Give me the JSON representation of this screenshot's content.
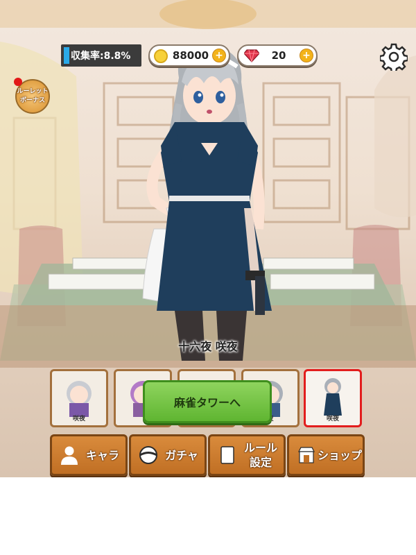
{
  "hud": {
    "collection_rate": "収集率:8.8%",
    "coins": "88000",
    "gems": "20",
    "coin_plus": "+",
    "gem_plus": "+"
  },
  "roulette_bonus": {
    "line1": "ルーレット",
    "line2": "ボーナス"
  },
  "character": {
    "name": "十六夜 咲夜"
  },
  "slots": [
    {
      "caption": "咲夜"
    },
    {
      "caption": ""
    },
    {
      "caption": ""
    },
    {
      "caption": "夜"
    },
    {
      "caption": "咲夜",
      "selected": true
    }
  ],
  "tower_button": "麻雀タワーへ",
  "menu": {
    "chara": "キャラ",
    "gacha": "ガチャ",
    "rules_line1": "ルール",
    "rules_line2": "設定",
    "shop": "ショップ"
  },
  "colors": {
    "accent_orange": "#c97a2e",
    "button_green": "#6fc23d",
    "selected_border": "#e21d1d",
    "hud_bar": "#2aa9e8"
  },
  "icons": [
    "coin-icon",
    "gem-icon",
    "plus-icon",
    "gear-icon",
    "person-icon",
    "gacha-ball-icon",
    "rulebook-icon",
    "shop-icon"
  ]
}
